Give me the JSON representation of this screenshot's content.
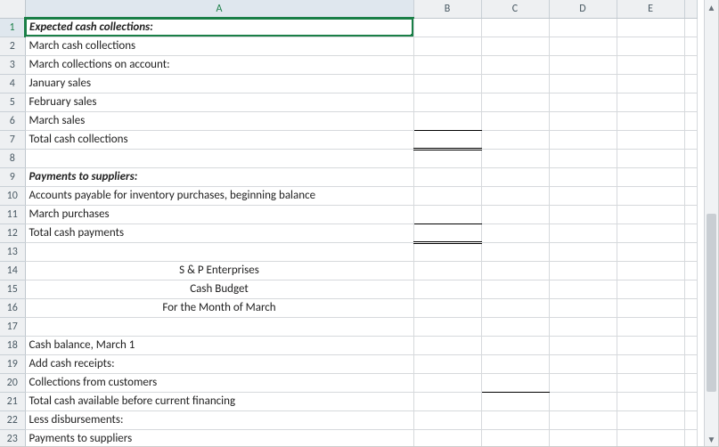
{
  "columns": [
    "A",
    "B",
    "C",
    "D",
    "E",
    ""
  ],
  "row_numbers": [
    "1",
    "2",
    "3",
    "4",
    "5",
    "6",
    "7",
    "8",
    "9",
    "10",
    "11",
    "12",
    "13",
    "14",
    "15",
    "16",
    "17",
    "18",
    "19",
    "20",
    "21",
    "22",
    "23"
  ],
  "active_cell": "A1",
  "rows": {
    "1": {
      "A": "Expected cash collections:"
    },
    "2": {
      "A": "March cash collections"
    },
    "3": {
      "A": "March collections on account:"
    },
    "4": {
      "A": "January sales"
    },
    "5": {
      "A": "February sales"
    },
    "6": {
      "A": "March sales"
    },
    "7": {
      "A": "Total cash collections"
    },
    "8": {
      "A": ""
    },
    "9": {
      "A": "Payments to suppliers:"
    },
    "10": {
      "A": "Accounts payable for inventory purchases, beginning balance"
    },
    "11": {
      "A": "March purchases"
    },
    "12": {
      "A": "Total cash payments"
    },
    "13": {
      "A": ""
    },
    "14": {
      "A": "S & P Enterprises"
    },
    "15": {
      "A": "Cash Budget"
    },
    "16": {
      "A": "For the Month of March"
    },
    "17": {
      "A": ""
    },
    "18": {
      "A": "Cash balance, March 1"
    },
    "19": {
      "A": "Add cash receipts:"
    },
    "20": {
      "A": "Collections from customers"
    },
    "21": {
      "A": "Total cash available before current financing"
    },
    "22": {
      "A": "Less disbursements:"
    },
    "23": {
      "A": "Payments to suppliers"
    }
  }
}
